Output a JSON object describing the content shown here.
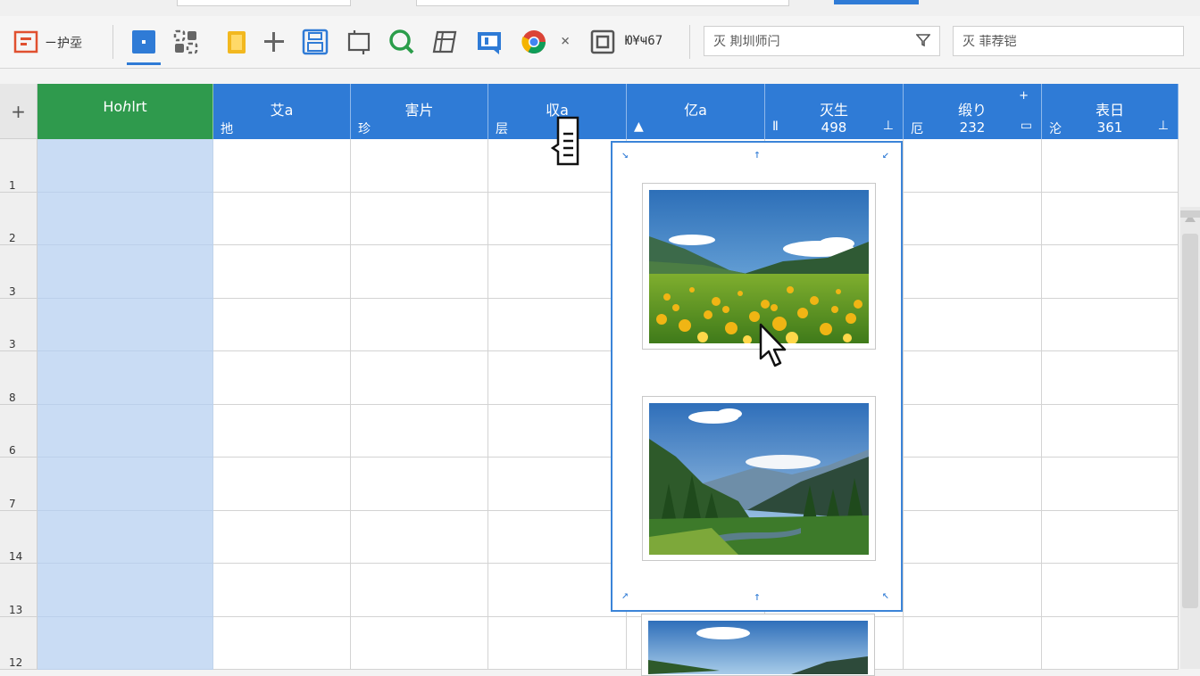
{
  "toolbar": {
    "app_label": "ㄧ护坖",
    "count_label": "Ю¥Ҹ67",
    "close_glyph": "×",
    "filter_input": {
      "value": "灭 剘圳师闩",
      "icon": "funnel-icon"
    },
    "search_input": {
      "value": "灭 菲荐铠"
    },
    "icons": [
      "app-logo-icon",
      "square-select-icon",
      "grid-icon",
      "clipboard-icon",
      "plus-icon",
      "save-icon",
      "crop-icon",
      "search-icon",
      "table-icon",
      "image-icon",
      "chrome-icon",
      "frame-icon"
    ]
  },
  "grid": {
    "corner_label": "+",
    "columns": [
      {
        "title": "Hoℎlrt",
        "sub_left": "",
        "sub_mid": "",
        "sub_right": "",
        "top_right": ""
      },
      {
        "title": "艾a",
        "sub_left": "扡",
        "sub_mid": "",
        "sub_right": "",
        "top_right": ""
      },
      {
        "title": "害片",
        "sub_left": "珍",
        "sub_mid": "",
        "sub_right": "",
        "top_right": ""
      },
      {
        "title": "収a",
        "sub_left": "层",
        "sub_mid": "",
        "sub_right": "",
        "top_right": ""
      },
      {
        "title": "亿a",
        "sub_left": "▲",
        "sub_mid": "",
        "sub_right": "",
        "top_right": ""
      },
      {
        "title": "灭生",
        "sub_left": "Ⅱ",
        "sub_mid": "498",
        "sub_right": "⊥",
        "top_right": ""
      },
      {
        "title": "缎り",
        "sub_left": "厄",
        "sub_mid": "232",
        "sub_right": "▭",
        "top_right": "+"
      },
      {
        "title": "表日",
        "sub_left": "沦",
        "sub_mid": "361",
        "sub_right": "⊥",
        "top_right": ""
      }
    ],
    "row_numbers": [
      "1",
      "2",
      "3",
      "3",
      "8",
      "6",
      "7",
      "14",
      "13",
      "12"
    ]
  },
  "panel": {
    "marks": {
      "top_left": "↘",
      "top_mid": "↑",
      "top_right": "↙",
      "bottom_left": "↗",
      "bottom_mid": "↑",
      "bottom_right": "↖"
    },
    "photos": [
      {
        "subject": "mountain meadow with yellow flowers"
      },
      {
        "subject": "forest valley with mountains"
      },
      {
        "subject": "mountain landscape (partially visible)"
      }
    ]
  },
  "colors": {
    "header_blue": "#2f7bd6",
    "header_green": "#2f9a4d",
    "selected_cell": "#c9dcf4"
  }
}
